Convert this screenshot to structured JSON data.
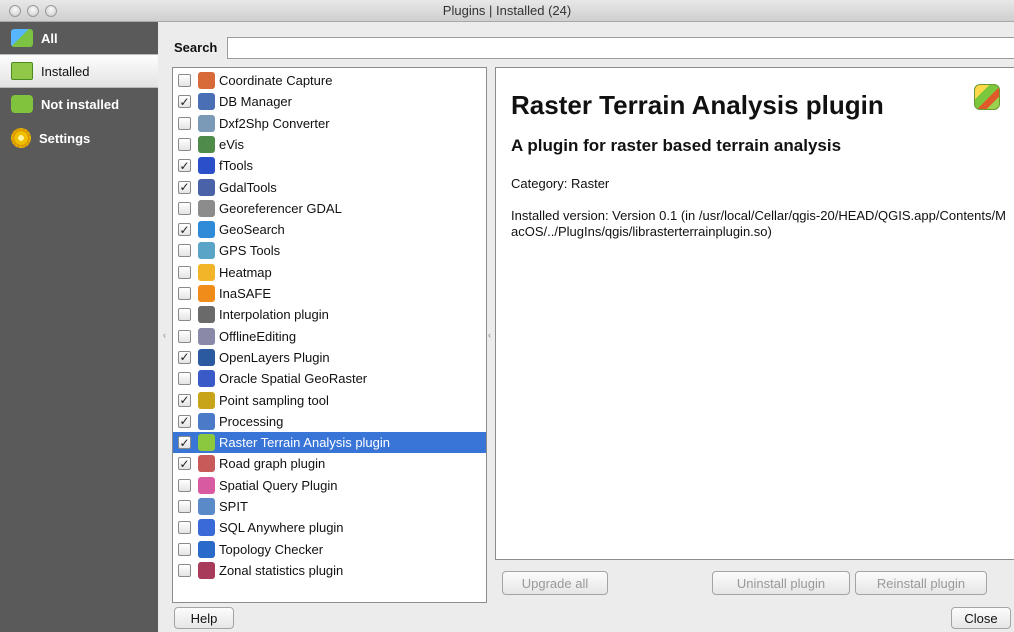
{
  "window": {
    "title": "Plugins | Installed (24)"
  },
  "sidebar": {
    "items": [
      {
        "label": "All",
        "icon": "all-plugins-icon"
      },
      {
        "label": "Installed",
        "icon": "installed-plugins-icon",
        "active": true
      },
      {
        "label": "Not installed",
        "icon": "not-installed-icon"
      },
      {
        "label": "Settings",
        "icon": "settings-gear-icon"
      }
    ]
  },
  "search": {
    "label": "Search",
    "value": ""
  },
  "plugins": [
    {
      "name": "Coordinate Capture",
      "checked": false,
      "icon_color": "#d86a3a"
    },
    {
      "name": "DB Manager",
      "checked": true,
      "icon_color": "#4a6fb5"
    },
    {
      "name": "Dxf2Shp Converter",
      "checked": false,
      "icon_color": "#7a9ab8"
    },
    {
      "name": "eVis",
      "checked": false,
      "icon_color": "#4f8c4a"
    },
    {
      "name": "fTools",
      "checked": true,
      "icon_color": "#2a4fc8"
    },
    {
      "name": "GdalTools",
      "checked": true,
      "icon_color": "#4a62a8"
    },
    {
      "name": "Georeferencer GDAL",
      "checked": false,
      "icon_color": "#8c8c8c"
    },
    {
      "name": "GeoSearch",
      "checked": true,
      "icon_color": "#2f8ad8"
    },
    {
      "name": "GPS Tools",
      "checked": false,
      "icon_color": "#5aa4c8"
    },
    {
      "name": "Heatmap",
      "checked": false,
      "icon_color": "#f2b52a"
    },
    {
      "name": "InaSAFE",
      "checked": false,
      "icon_color": "#f08c1a"
    },
    {
      "name": "Interpolation plugin",
      "checked": false,
      "icon_color": "#6a6a6a"
    },
    {
      "name": "OfflineEditing",
      "checked": false,
      "icon_color": "#8a8aa8"
    },
    {
      "name": "OpenLayers Plugin",
      "checked": true,
      "icon_color": "#2c5aa0"
    },
    {
      "name": "Oracle Spatial GeoRaster",
      "checked": false,
      "icon_color": "#3a5ac8"
    },
    {
      "name": "Point sampling tool",
      "checked": true,
      "icon_color": "#c8a41a"
    },
    {
      "name": "Processing",
      "checked": true,
      "icon_color": "#4a7ac8"
    },
    {
      "name": "Raster Terrain Analysis plugin",
      "checked": true,
      "icon_color": "#8bc83d",
      "selected": true
    },
    {
      "name": "Road graph plugin",
      "checked": true,
      "icon_color": "#c85a5a"
    },
    {
      "name": "Spatial Query Plugin",
      "checked": false,
      "icon_color": "#d85aa0"
    },
    {
      "name": "SPIT",
      "checked": false,
      "icon_color": "#5a8ac8"
    },
    {
      "name": "SQL Anywhere plugin",
      "checked": false,
      "icon_color": "#3a6ad8"
    },
    {
      "name": "Topology Checker",
      "checked": false,
      "icon_color": "#2a6ac8"
    },
    {
      "name": "Zonal statistics plugin",
      "checked": false,
      "icon_color": "#a83a5a"
    }
  ],
  "details": {
    "title": "Raster Terrain Analysis plugin",
    "subtitle": "A plugin for raster based terrain analysis",
    "category": "Category: Raster",
    "installed_version": "Installed version: Version 0.1 (in /usr/local/Cellar/qgis-20/HEAD/QGIS.app/Contents/MacOS/../PlugIns/qgis/librasterterrainplugin.so)"
  },
  "buttons": {
    "upgrade_all": "Upgrade all",
    "uninstall": "Uninstall plugin",
    "reinstall": "Reinstall plugin",
    "help": "Help",
    "close": "Close"
  },
  "colors": {
    "sidebar_bg": "#5a5a5a",
    "selection": "#3875d7"
  }
}
